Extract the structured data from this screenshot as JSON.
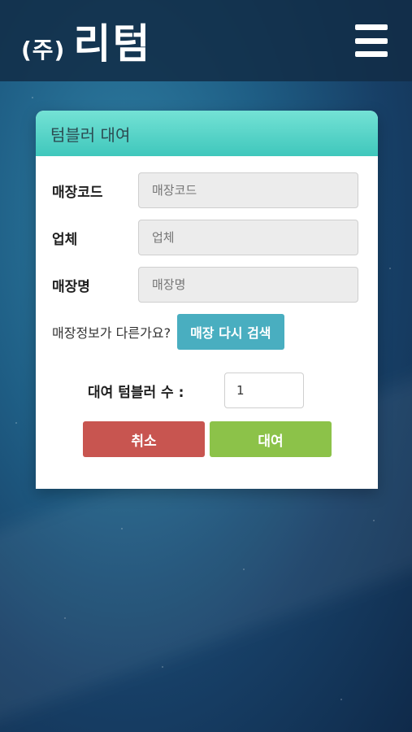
{
  "header": {
    "logo_small": "(주)",
    "logo_big": "리텀"
  },
  "panel": {
    "title": "텀블러 대여"
  },
  "form": {
    "store_code": {
      "label": "매장코드",
      "placeholder": "매장코드"
    },
    "company": {
      "label": "업체",
      "placeholder": "업체"
    },
    "store_name": {
      "label": "매장명",
      "placeholder": "매장명"
    },
    "mismatch_text": "매장정보가 다른가요?",
    "search_again_label": "매장 다시 검색",
    "count_label": "대여 텀블러 수 :",
    "count_value": "1"
  },
  "actions": {
    "cancel_label": "취소",
    "rent_label": "대여"
  },
  "colors": {
    "panel_header": "#4fd2c7",
    "search_button": "#49aec0",
    "cancel_button": "#c85550",
    "rent_button": "#8cc249"
  },
  "icons": {
    "menu": "hamburger-menu-icon"
  }
}
